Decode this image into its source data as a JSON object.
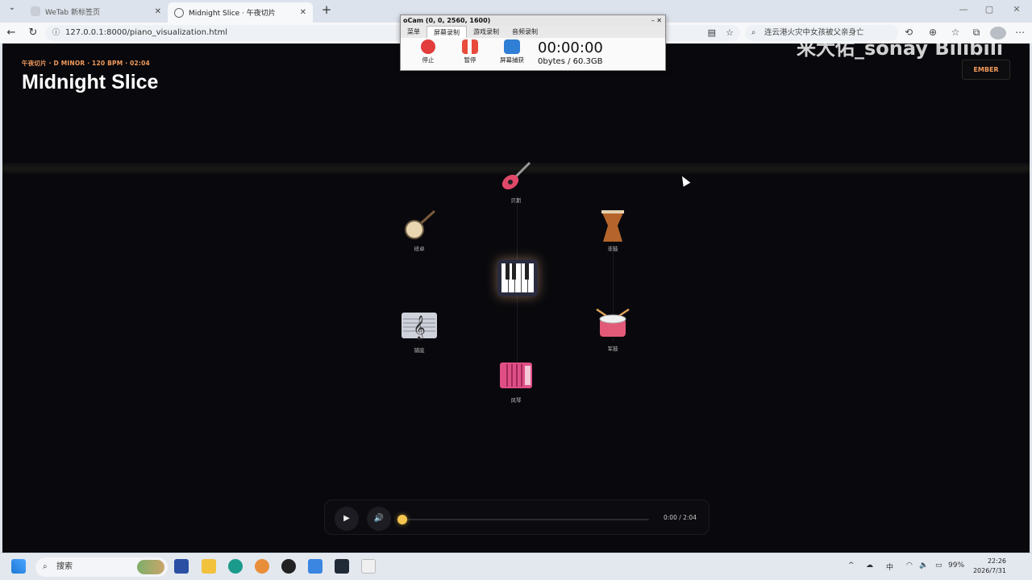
{
  "browser": {
    "tabs": [
      {
        "title": "WeTab 新标签页",
        "active": false
      },
      {
        "title": "Midnight Slice · 午夜切片",
        "active": true
      }
    ],
    "url": "127.0.0.1:8000/piano_visualization.html",
    "search_text": "连云港火灾中女孩被父亲身亡"
  },
  "page": {
    "subtitle": "午夜切片 · D MINOR · 120 BPM · 02:04",
    "title": "Midnight Slice",
    "theme_button": "EMBER",
    "watermark": "来大佑_sonay Bilibili"
  },
  "instruments": [
    {
      "label": "贝斯",
      "icon": "electric-guitar-icon"
    },
    {
      "label": "班卓",
      "icon": "banjo-icon"
    },
    {
      "label": "非鼓",
      "icon": "djembe-icon"
    },
    {
      "label": "钢琴",
      "icon": "piano-icon"
    },
    {
      "label": "铺底",
      "icon": "treble-clef-sheet-icon"
    },
    {
      "label": "军鼓",
      "icon": "snare-drum-icon"
    },
    {
      "label": "风琴",
      "icon": "accordion-icon"
    }
  ],
  "player": {
    "play_icon": "play-icon",
    "volume_icon": "volume-icon",
    "time": "0:00 / 2:04",
    "progress": 0
  },
  "pcam": {
    "title": "oCam (0, 0, 2560, 1600)",
    "tabs": [
      "菜单",
      "屏幕录制",
      "游戏录制",
      "音频录制"
    ],
    "buttons": [
      "停止",
      "暂停",
      "屏幕捕获"
    ],
    "time": "00:00:00",
    "size": "0bytes / 60.3GB"
  },
  "taskbar": {
    "search_label": "搜索",
    "ime": "中",
    "battery": "99%",
    "time": "22:26",
    "date": "2026/7/31"
  }
}
